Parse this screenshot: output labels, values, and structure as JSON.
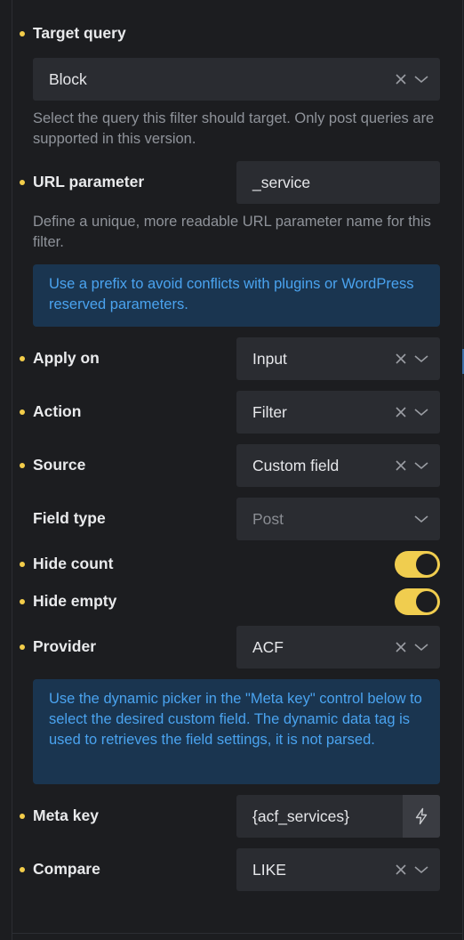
{
  "target_query": {
    "label": "Target query",
    "value": "Block",
    "help": "Select the query this filter should target. Only post queries are supported in this version."
  },
  "url_parameter": {
    "label": "URL parameter",
    "value": "_service",
    "help": "Define a unique, more readable URL parameter name for this filter.",
    "info": "Use a prefix to avoid conflicts with plugins or WordPress reserved parameters."
  },
  "apply_on": {
    "label": "Apply on",
    "value": "Input"
  },
  "action": {
    "label": "Action",
    "value": "Filter"
  },
  "source": {
    "label": "Source",
    "value": "Custom field"
  },
  "field_type": {
    "label": "Field type",
    "placeholder": "Post"
  },
  "hide_count": {
    "label": "Hide count",
    "enabled": true
  },
  "hide_empty": {
    "label": "Hide empty",
    "enabled": true
  },
  "provider": {
    "label": "Provider",
    "value": "ACF",
    "info": "Use the dynamic picker in the \"Meta key\" control below to select the desired custom field. The dynamic data tag is used to retrieves the field settings, it is not parsed."
  },
  "meta_key": {
    "label": "Meta key",
    "value": "{acf_services}",
    "button_icon": "bolt-icon"
  },
  "compare": {
    "label": "Compare",
    "value": "LIKE"
  },
  "colors": {
    "accent": "#f0cd4f",
    "info_bg": "#1a3550",
    "info_text": "#4aa3ef"
  }
}
